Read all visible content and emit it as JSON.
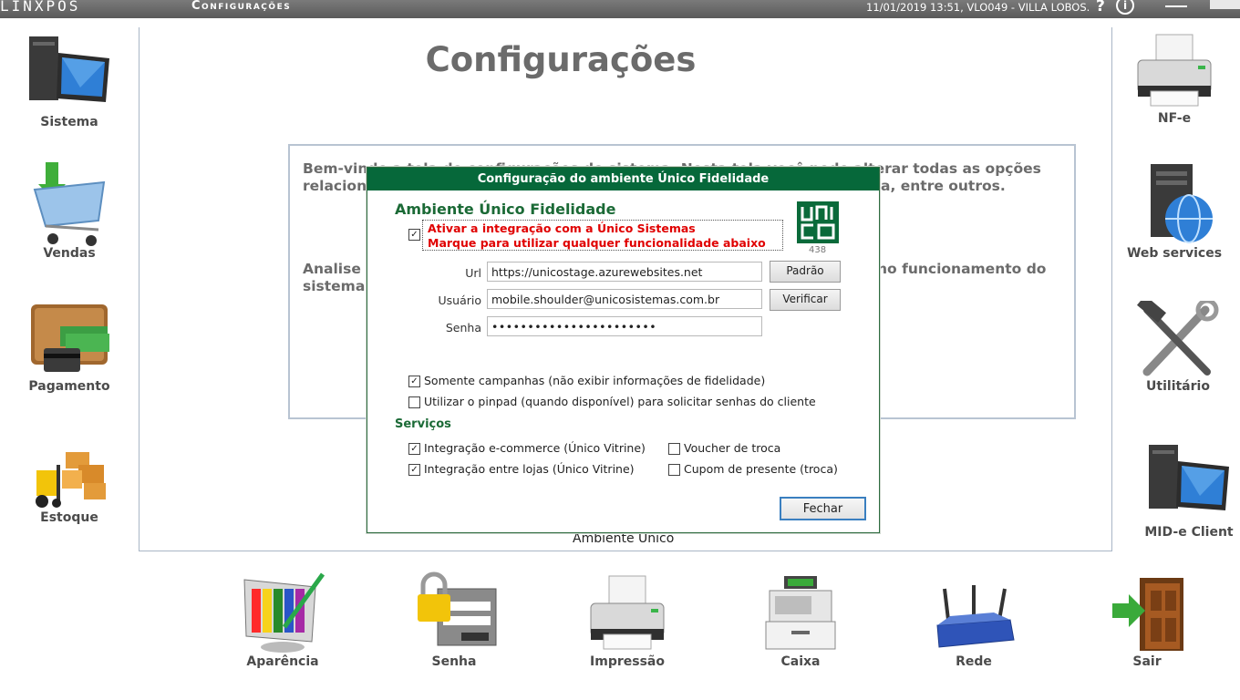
{
  "topbar": {
    "logo": "LINXPOS",
    "title": "Configurações",
    "status": "11/01/2019 13:51, VLO049 - VILLA LOBOS.",
    "help_label": "?",
    "info_label": "i"
  },
  "left_menu": [
    {
      "label": "Sistema",
      "icon": "computer-icon"
    },
    {
      "label": "Vendas",
      "icon": "shopping-cart-icon"
    },
    {
      "label": "Pagamento",
      "icon": "wallet-icon"
    },
    {
      "label": "Estoque",
      "icon": "forklift-icon"
    }
  ],
  "right_menu": [
    {
      "label": "NF-e",
      "icon": "printer-icon"
    },
    {
      "label": "Web services",
      "icon": "server-globe-icon"
    },
    {
      "label": "Utilitário",
      "icon": "tools-icon"
    },
    {
      "label": "MID-e Client",
      "icon": "computer-icon"
    }
  ],
  "bottom_menu": [
    {
      "label": "Aparência",
      "icon": "paint-icon"
    },
    {
      "label": "Senha",
      "icon": "lock-icon"
    },
    {
      "label": "Impressão",
      "icon": "printer-icon"
    },
    {
      "label": "Caixa",
      "icon": "cash-register-icon"
    },
    {
      "label": "Rede",
      "icon": "router-icon"
    },
    {
      "label": "Sair",
      "icon": "exit-door-icon"
    }
  ],
  "main": {
    "title": "Configurações",
    "welcome_line1_left": "Bem-vindo a tela de configurações do sistema. Nesta tela você pode alterar todas as opções",
    "welcome_line2_left": "relaciona",
    "welcome_line2_right": "a, entre outros.",
    "analise_line1_left": "Analise c",
    "analise_line1_right": "no funcionamento do",
    "analise_line2": "sistema.",
    "ambient_label": "Ambiente Unico"
  },
  "dialog": {
    "title": "Configuração do ambiente Único Fidelidade",
    "section_title": "Ambiente Único Fidelidade",
    "activate_line1": "Ativar a integração com a Único Sistemas",
    "activate_line2": "Marque para utilizar qualquer funcionalidade abaixo",
    "activate_checked": "☑",
    "logo_text": "UNICO",
    "version": "438",
    "url_label": "Url",
    "url_value": "https://unicostage.azurewebsites.net",
    "user_label": "Usuário",
    "user_value": "mobile.shoulder@unicosistemas.com.br",
    "password_label": "Senha",
    "password_value": "•••••••••••••••••••••••",
    "padrao_button": "Padrão",
    "verificar_button": "Verificar",
    "option_campanhas": "Somente campanhas (não exibir informações de fidelidade)",
    "option_pinpad": "Utilizar o pinpad (quando disponível) para solicitar senhas do cliente",
    "services_title": "Serviços",
    "service_ecommerce": "Integração e-commerce (Único Vitrine)",
    "service_lojas": "Integração entre lojas (Único Vitrine)",
    "service_voucher": "Voucher de troca",
    "service_cupom": "Cupom de presente (troca)",
    "close_button": "Fechar",
    "check_mark": "✓"
  }
}
